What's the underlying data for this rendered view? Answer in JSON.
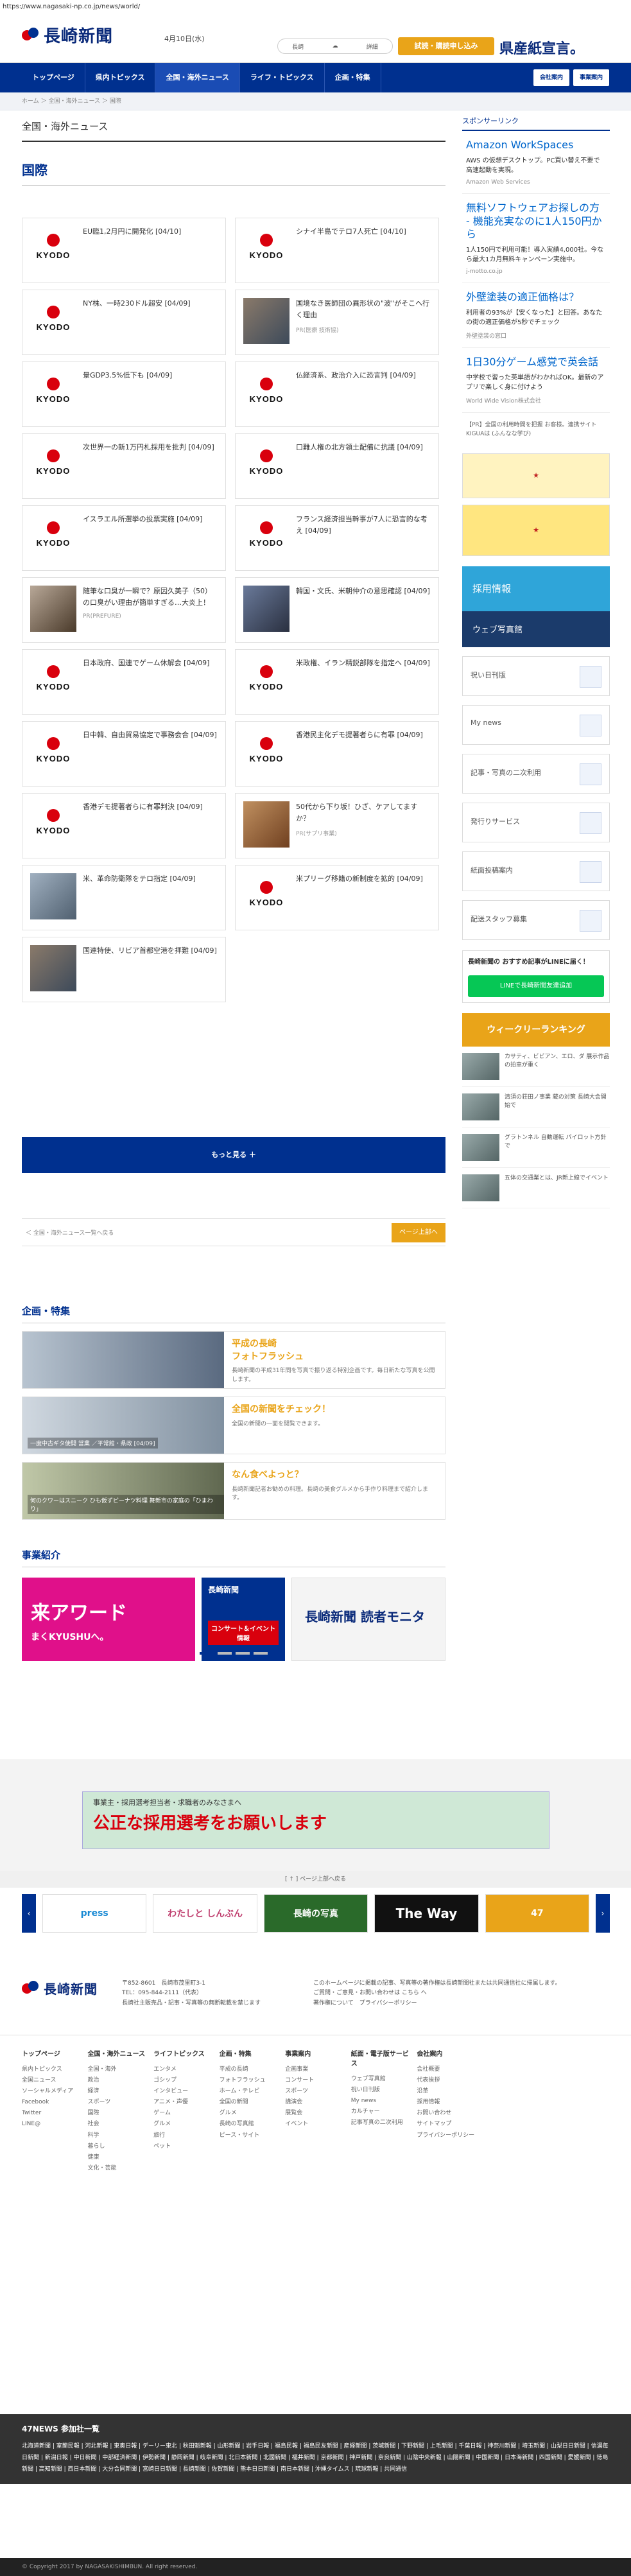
{
  "url": "https://www.nagasaki-np.co.jp/news/world/",
  "header": {
    "logo_text": "長崎新聞",
    "date": "4月10日(水)",
    "weather_label": "長崎",
    "weather_detail": "",
    "weather_link": "詳細",
    "trial_button": "試読・購読申し込み",
    "banner_text": "県産紙宣言。"
  },
  "nav": {
    "items": [
      "トップページ",
      "県内トピックス",
      "全国・海外ニュース",
      "ライフ・トピックス",
      "企画・特集"
    ],
    "right_buttons": [
      "会社案内",
      "事業案内"
    ]
  },
  "breadcrumb": "ホーム ＞ 全国・海外ニュース ＞ 国際",
  "section_title": "全国・海外ニュース",
  "category_title": "国際",
  "articles": [
    {
      "title": "EU臨1,2月円に開発化 [04/10]",
      "sub": "",
      "thumb": "kyodo"
    },
    {
      "title": "シナイ半島でテロ7人死亡 [04/10]",
      "sub": "",
      "thumb": "kyodo"
    },
    {
      "title": "NY株、一時230ドル超安 [04/09]",
      "sub": "",
      "thumb": "kyodo"
    },
    {
      "title": "国境なき医師団の異形状の\"波\"がそこへ行く理由",
      "sub": "PR(医療 技術協)",
      "thumb": "photo"
    },
    {
      "title": "景GDP3.5%低下も [04/09]",
      "sub": "",
      "thumb": "kyodo"
    },
    {
      "title": "仏経済系、政治介入に恐言判 [04/09]",
      "sub": "",
      "thumb": "kyodo"
    },
    {
      "title": "次世界一の新1万円札採用を批判 [04/09]",
      "sub": "",
      "thumb": "kyodo"
    },
    {
      "title": "口難人権の北方領土配備に抗議 [04/09]",
      "sub": "",
      "thumb": "kyodo"
    },
    {
      "title": "イスラエル所選挙の投票実施 [04/09]",
      "sub": "",
      "thumb": "kyodo"
    },
    {
      "title": "フランス経済担当幹事が7人に恐言的な考え [04/09]",
      "sub": "",
      "thumb": "kyodo"
    },
    {
      "title": "随筆な口臭が一瞬で？原因久美子（50）の口臭がい理由が簡単すぎる…大炎上！",
      "sub": "PR(PREFURE)",
      "thumb": "photo"
    },
    {
      "title": "韓国・文氏、米朝仲介の意思確認 [04/09]",
      "sub": "",
      "thumb": "photo"
    },
    {
      "title": "日本政府、国連でゲーム休解会 [04/09]",
      "sub": "",
      "thumb": "kyodo"
    },
    {
      "title": "米政権、イラン精鋭部隊を指定へ [04/09]",
      "sub": "",
      "thumb": "kyodo"
    },
    {
      "title": "日中韓、自由貿易協定で事務会合 [04/09]",
      "sub": "",
      "thumb": "kyodo"
    },
    {
      "title": "香港民主化デモ提著者らに有罪 [04/09]",
      "sub": "",
      "thumb": "kyodo"
    },
    {
      "title": "香港デモ提著者らに有罪判決 [04/09]",
      "sub": "",
      "thumb": "kyodo"
    },
    {
      "title": "50代から下り坂！ひざ、ケアしてますか？",
      "sub": "PR(サプリ事業)",
      "thumb": "photo"
    },
    {
      "title": "米、革命防衛隊をテロ指定 [04/09]",
      "sub": "",
      "thumb": "photo"
    },
    {
      "title": "米プリーグ移籍の新制度を拡的 [04/09]",
      "sub": "",
      "thumb": "kyodo"
    },
    {
      "title": "国連特使、リビア首都空港を拝難 [04/09]",
      "sub": "",
      "thumb": "photo"
    }
  ],
  "more_button": "もっと見る ＋",
  "back_link": "＜ 全国・海外ニュース一覧へ戻る",
  "top_button": "ページ上部へ",
  "feature": {
    "heading": "企画・特集",
    "items": [
      {
        "caption": "平成の長崎 フォトフラッシュ",
        "title": "平成の長崎\nフォトフラッシュ",
        "desc": "長崎新聞の平成31年間を写真で振り返る特別企画です。毎日新たな写真を公開します。"
      },
      {
        "caption": "一度中古ギタ使開 営業 ／平常館・県政 [04/09]",
        "title": "全国の新聞をチェック！",
        "desc": "全国の新聞の一面を閲覧できます。"
      },
      {
        "caption": "何のクワーはスニーク ひも仮ずピーナツ料理 舞新市の家庭の「ひまわり」",
        "title": "なん食べよっと？",
        "desc": "長崎新聞記者お勧めの料理。長崎の美食グルメから手作り料理まで紹介します。"
      }
    ]
  },
  "jigyo": {
    "heading": "事業紹介",
    "b1": "来アワード",
    "b1_sub": "まくKYUSHUへ。",
    "b2_title": "長崎新聞",
    "b2_sub": "コンサート＆イベント情報",
    "b3": "長崎新聞 読者モニタ"
  },
  "sidebar": {
    "sponsor_heading": "スポンサーリンク",
    "ads": [
      {
        "title": "Amazon WorkSpaces",
        "desc": "AWS の仮想デスクトップ。PC買い替え不要で高速起動を実現。",
        "src": "Amazon Web Services"
      },
      {
        "title": "無料ソフトウェアお探しの方 - 機能充実なのに1人150円から",
        "desc": "1人150円で利用可能！導入実績4,000社。今なら最大1カ月無料キャンペーン実施中。",
        "src": "j-motto.co.jp"
      },
      {
        "title": "外壁塗装の適正価格は？",
        "desc": "利用者の93%が【安くなった】と回答。あなたの街の適正価格が5秒でチェック",
        "src": "外壁塗装の窓口"
      },
      {
        "title": "1日30分ゲーム感覚で英会話",
        "desc": "中学校で習った英単語がわかればOK。最新のアプリで楽しく身に付けよう",
        "src": "World Wide Vision株式会社"
      }
    ],
    "pr_note": "【PR】全国の利用時間を把握 お客様。連携サイト KIGUAは (ふんなな学び)",
    "saiyo": "採用情報",
    "web_sa": "ウェブ写真館",
    "boxes": [
      "祝い日刊版",
      "My news",
      "記事・写真の二次利用",
      "発行りサービス",
      "紙面投稿案内",
      "配送スタッフ募集"
    ],
    "line_text": "長崎新聞の おすすめ記事がLINEに届く！",
    "line_btn": "LINEで長崎新聞友達追加",
    "rank_head": "ウィークリーランキング",
    "rank": [
      "カサティ、ビビアン、エロ、ダ 展示作品の拍車が重く",
      "清須の荘田ノ事業 蔵の対策 長崎大会開始で",
      "グラトンネル 自動運転 パイロット方針で",
      "五体の交通業とは、JR新上線でイベント"
    ]
  },
  "bottom_ad": {
    "line1": "事業主・採用選考担当者・求職者のみなさまへ",
    "line2": "公正な採用選考をお願いします"
  },
  "carousel": {
    "head": "[ ↑ ] ページ上部へ戻る",
    "items": [
      "press",
      "わたしと しんぶん",
      "長崎の写真",
      "The Way",
      "47"
    ]
  },
  "footer": {
    "addr": "〒852-8601　長崎市茂里町3-1\nTEL：095-844-2111（代表）\n長崎社主販売品・記事・写真等の無断転載を禁じます",
    "note": "このホームページに掲載の記事、写真等の著作権は長崎新聞社または共同通信社に帰属します。\nご質問・ご意見・お問い合わせは こちら へ\n著作権について　プライバシーポリシー",
    "cols": [
      {
        "head": "トップページ",
        "items": [
          "県内トピックス",
          "全国ニュース",
          "ソーシャルメディア",
          "Facebook",
          "Twitter",
          "LINE@"
        ]
      },
      {
        "head": "全国・海外ニュース",
        "items": [
          "全国・海外",
          "政治",
          "経済",
          "スポーツ",
          "国際",
          "社会",
          "科学",
          "暮らし",
          "健康",
          "文化・芸能"
        ]
      },
      {
        "head": "ライフトピックス",
        "items": [
          "エンタメ",
          "ゴシップ",
          "インタビュー",
          "アニメ・声優",
          "ゲーム",
          "グルメ",
          "旅行",
          "ペット"
        ]
      },
      {
        "head": "企画・特集",
        "items": [
          "平成の長崎",
          "フォトフラッシュ",
          "ホーム・テレビ",
          "全国の新聞",
          "グルメ",
          "長崎の写真館",
          "ピース・サイト"
        ]
      },
      {
        "head": "事業案内",
        "items": [
          "企画事業",
          "コンサート",
          "スポーツ",
          "講演会",
          "展覧会",
          "イベント"
        ]
      },
      {
        "head": "紙面・電子版サービス",
        "items": [
          "ウェブ写真館",
          "祝い日刊版",
          "My news",
          "カルチャー",
          "記事写真の二次利用"
        ]
      },
      {
        "head": "会社案内",
        "items": [
          "会社概要",
          "代表挨拶",
          "沿革",
          "採用情報",
          "お問い合わせ",
          "サイトマップ",
          "プライバシーポリシー"
        ]
      }
    ]
  },
  "news47": {
    "heading": "47NEWS 参加社一覧",
    "list": "北海道新聞 | 室蘭民報 | 河北新報 | 東奥日報 | デーリー東北 | 秋田魁新報 | 山形新聞 | 岩手日報 | 福島民報 | 福島民友新聞 | 産経新聞 | 茨城新聞 | 下野新聞 | 上毛新聞 | 千葉日報 | 神奈川新聞 | 埼玉新聞 | 山梨日日新聞 | 信濃毎日新聞 | 新潟日報 | 中日新聞 | 中部経済新聞 | 伊勢新聞 | 静岡新聞 | 岐阜新聞 | 北日本新聞 | 北國新聞 | 福井新聞 | 京都新聞 | 神戸新聞 | 奈良新聞 | 山陰中央新報 | 山陽新聞 | 中国新聞 | 日本海新聞 | 四国新聞 | 愛媛新聞 | 徳島新聞 | 高知新聞 | 西日本新聞 | 大分合同新聞 | 宮崎日日新聞 | 長崎新聞 | 佐賀新聞 | 熊本日日新聞 | 南日本新聞 | 沖縄タイムス | 琉球新報 | 共同通信"
  },
  "copyright": "© Copyright 2017 by NAGASAKISHIMBUN. All right reserved."
}
